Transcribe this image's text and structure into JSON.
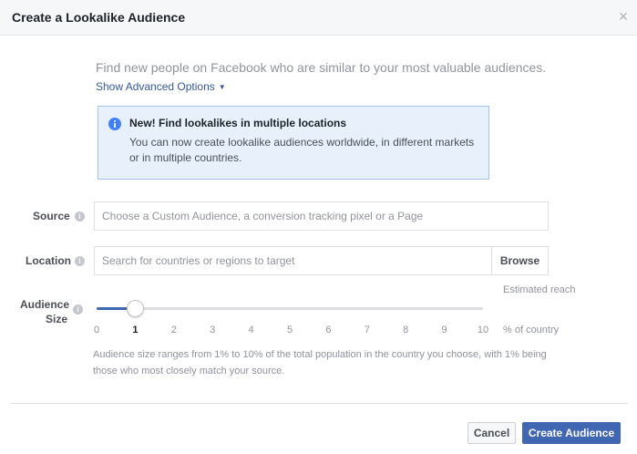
{
  "dialog": {
    "title": "Create a Lookalike Audience",
    "close_icon": "close-icon"
  },
  "intro": {
    "text": "Find new people on Facebook who are similar to your most valuable audiences.",
    "advanced_link": "Show Advanced Options"
  },
  "notice": {
    "icon": "info-icon",
    "title": "New! Find lookalikes in multiple locations",
    "body": "You can now create lookalike audiences worldwide, in different markets or in multiple countries."
  },
  "source": {
    "label": "Source",
    "placeholder": "Choose a Custom Audience, a conversion tracking pixel or a Page",
    "value": ""
  },
  "location": {
    "label": "Location",
    "placeholder": "Search for countries or regions to target",
    "value": "",
    "browse_label": "Browse"
  },
  "audience_size": {
    "label_line1": "Audience",
    "label_line2": "Size",
    "estimated_reach_label": "Estimated reach",
    "ticks": [
      "0",
      "1",
      "2",
      "3",
      "4",
      "5",
      "6",
      "7",
      "8",
      "9",
      "10"
    ],
    "selected_value": 1,
    "min": 0,
    "max": 10,
    "unit_label": "% of country",
    "note": "Audience size ranges from 1% to 10% of the total population in the country you choose, with 1% being those who most closely match your source."
  },
  "footer": {
    "cancel_label": "Cancel",
    "create_label": "Create Audience"
  },
  "colors": {
    "accent": "#4267b2",
    "link": "#365899",
    "info_blue": "#4080ff"
  }
}
